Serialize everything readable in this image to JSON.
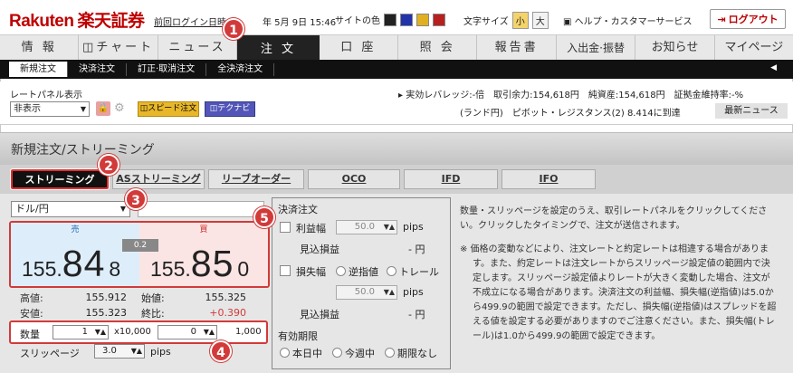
{
  "header": {
    "logo_en": "Rakuten",
    "logo_jp": "楽天証券",
    "last_login_label": "前回ログイン日時",
    "last_login_date": "年 5月 9日 15:46",
    "site_color_label": "サイトの色",
    "site_colors": [
      "#222222",
      "#2233aa",
      "#e0b020",
      "#b81f1f"
    ],
    "font_size_label": "文字サイズ",
    "font_small": "小",
    "font_large": "大",
    "help_label": "ヘルプ・カスタマーサービス",
    "logout_label": "ログアウト"
  },
  "nav": {
    "tabs": [
      "情 報",
      "チャート",
      "ニュース",
      "注 文",
      "口 座",
      "照 会",
      "報告書",
      "入出金·振替",
      "お知らせ",
      "マイページ"
    ],
    "active": "注 文"
  },
  "subnav": {
    "items": [
      "新規注文",
      "決済注文",
      "訂正·取消注文",
      "全決済注文"
    ]
  },
  "ratepanel": {
    "label": "レートパネル表示",
    "select_value": "非表示",
    "speed_order": "スピード注文",
    "tech_navi": "テクナビ",
    "leverage_info": "▸ 実効レバレッジ:-倍　取引余力:154,618円　純資産:154,618円　証拠金維持率:-%",
    "news_text": "(ランド円)　ピボット・レジスタンス(2) 8.414に到達",
    "latest_news": "最新ニュース"
  },
  "page_title": "新規注文/ストリーミング",
  "order_tabs": [
    "ストリーミング",
    "ASストリーミング",
    "リーブオーダー",
    "OCO",
    "IFD",
    "IFO"
  ],
  "pair": "ドル/円",
  "quote": {
    "bid_label": "売",
    "ask_label": "買",
    "spread": "0.2",
    "bid": {
      "prefix": "155.",
      "big": "84",
      "tail": "8"
    },
    "ask": {
      "prefix": "155.",
      "big": "85",
      "tail": "0"
    }
  },
  "stats": {
    "high_label": "高値:",
    "high": "155.912",
    "open_label": "始値:",
    "open": "155.325",
    "low_label": "安値:",
    "low": "155.323",
    "close_label": "終比:",
    "close": "+0.390"
  },
  "quantity": {
    "label": "数量",
    "value1": "1",
    "multiplier": "x10,000",
    "value2": "0",
    "rest": "1,000"
  },
  "slippage": {
    "label": "スリッページ",
    "value": "3.0",
    "unit": "pips"
  },
  "settlement": {
    "title": "決済注文",
    "profit_label": "利益幅",
    "profit_value": "50.0",
    "unit": "pips",
    "est_pl_label": "見込損益",
    "est_pl_value": "- 円",
    "loss_label": "損失幅",
    "stop_label": "逆指値",
    "trail_label": "トレール",
    "loss_value": "50.0",
    "validity_label": "有効期限",
    "validity_options": [
      "本日中",
      "今週中",
      "期限なし"
    ]
  },
  "notes": {
    "intro": "数量・スリッページを設定のうえ、取引レートパネルをクリックしてください。クリックしたタイミングで、注文が送信されます。",
    "caution": "※ 価格の変動などにより、注文レートと約定レートは相違する場合があります。また、約定レートは注文レートからスリッページ設定値の範囲内で決定します。スリッページ設定値よりレートが大きく変動した場合、注文が不成立になる場合があります。決済注文の利益幅、損失幅(逆指値)は5.0から499.9の範囲で設定できます。ただし、損失幅(逆指値)はスプレッドを超える値を設定する必要がありますのでご注意ください。また、損失幅(トレール)は1.0から499.9の範囲で設定できます。"
  },
  "markers": [
    "1",
    "2",
    "3",
    "4",
    "5"
  ]
}
